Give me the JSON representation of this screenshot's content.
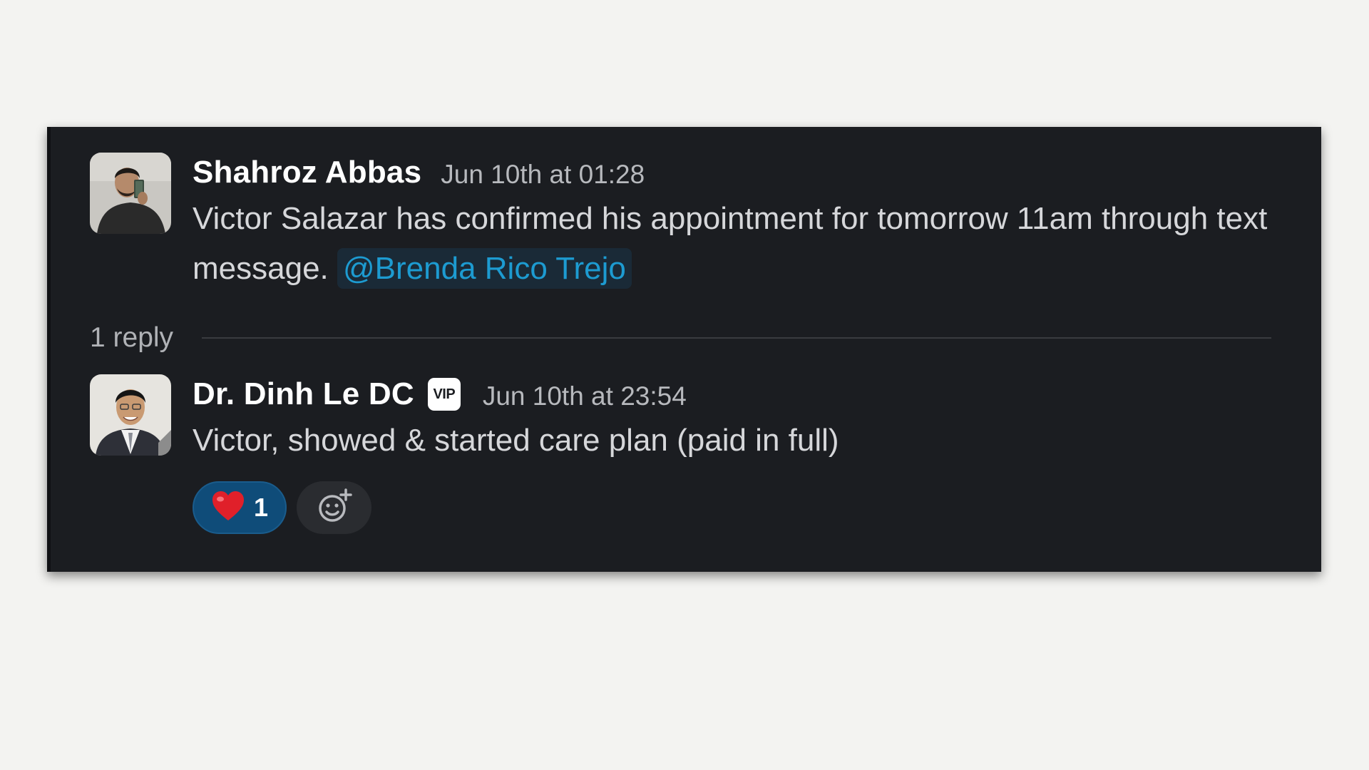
{
  "thread": {
    "parent": {
      "author": "Shahroz Abbas",
      "timestamp": "Jun 10th at 01:28",
      "text": "Victor Salazar has confirmed his appointment for tomorrow 11am through text message.",
      "mention": "@Brenda Rico Trejo"
    },
    "reply_count": "1 reply",
    "reply": {
      "author": "Dr. Dinh Le DC",
      "badge": "VIP",
      "timestamp": "Jun 10th at 23:54",
      "text": "Victor, showed & started care plan (paid in full)",
      "reactions": [
        {
          "emoji": "heart-emoji",
          "count": "1"
        }
      ],
      "add_reaction_icon": "add-reaction-icon"
    }
  },
  "colors": {
    "card_background": "#1b1d21",
    "page_background": "#f3f3f1",
    "mention_text": "#1d9bd1",
    "mention_background": "#1a2a37",
    "reaction_selected": "#0f4c79"
  }
}
